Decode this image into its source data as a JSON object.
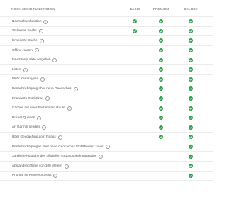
{
  "header": {
    "feature_col": "NOCH MEHR FUNKTIONEN",
    "basis": "BASIS",
    "premium": "PREMIUM",
    "deluxe": "DELUXE"
  },
  "info_glyph": "i",
  "check_color": "#2ea14a",
  "features": [
    {
      "label": "Nachrichtenfunktion",
      "basis": true,
      "premium": true,
      "deluxe": true
    },
    {
      "label": "Weltweite Suche",
      "basis": true,
      "premium": true,
      "deluxe": true
    },
    {
      "label": "Erweiterte Suche",
      "basis": false,
      "premium": true,
      "deluxe": true
    },
    {
      "label": "Offline-Karten",
      "basis": false,
      "premium": true,
      "deluxe": true
    },
    {
      "label": "Favoritenpunkte vergeben",
      "basis": false,
      "premium": true,
      "deluxe": true
    },
    {
      "label": "Listen",
      "basis": false,
      "premium": true,
      "deluxe": true
    },
    {
      "label": "Mehr Kartentypen",
      "basis": false,
      "premium": true,
      "deluxe": true
    },
    {
      "label": "Benachrichtigung über neue Geocaches",
      "basis": false,
      "premium": true,
      "deluxe": true
    },
    {
      "label": "Erweiterte Statistiken",
      "basis": false,
      "premium": true,
      "deluxe": true
    },
    {
      "label": "Caches auf einer bestimmten Route",
      "basis": false,
      "premium": true,
      "deluxe": true
    },
    {
      "label": "Pocket Queries",
      "basis": false,
      "premium": true,
      "deluxe": true
    },
    {
      "label": "An Garmin senden",
      "basis": false,
      "premium": true,
      "deluxe": true
    },
    {
      "label": "Über Geocaching.com hinaus",
      "basis": false,
      "premium": true,
      "deluxe": true
    },
    {
      "label": "Benachrichtigungen über neue Geocaches fünf Minuten zuvor",
      "basis": false,
      "premium": false,
      "deluxe": true
    },
    {
      "label": "Jährliche Ausgabe des offiziellen Groundspeak-Magazins",
      "basis": false,
      "premium": false,
      "deluxe": true
    },
    {
      "label": "Abstandsrichtlinie von 100 Metern",
      "basis": false,
      "premium": false,
      "deluxe": true
    },
    {
      "label": "Priorität im Reviewprozess",
      "basis": false,
      "premium": false,
      "deluxe": true
    }
  ]
}
